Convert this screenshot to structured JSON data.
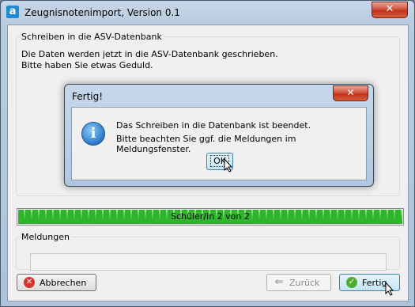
{
  "window": {
    "title": "Zeugnisnotenimport, Version 0.1",
    "app_icon_letter": "a",
    "close_glyph": "✕"
  },
  "section": {
    "legend": "Schreiben in die ASV-Datenbank",
    "line1": "Die Daten werden jetzt in die ASV-Datenbank geschrieben.",
    "line2": "Bitte haben Sie etwas Geduld."
  },
  "progress": {
    "text": "Schüler/in 2 von 2",
    "fraction": 1.0,
    "color": "#2fb52d"
  },
  "messages": {
    "legend": "Meldungen"
  },
  "buttons": {
    "cancel": {
      "label": "Abbrechen",
      "icon": "cancel-icon"
    },
    "back": {
      "label": "Zurück",
      "icon": "back-arrow-icon"
    },
    "finish": {
      "label": "Fertig",
      "icon": "check-icon"
    }
  },
  "dialog": {
    "title": "Fertig!",
    "icon": "info-icon",
    "message_line1": "Das Schreiben in die Datenbank ist beendet.",
    "message_line2": "Bitte beachten Sie ggf. die Meldungen im Meldungsfenster.",
    "ok_label": "OK",
    "close_glyph": "✕"
  }
}
